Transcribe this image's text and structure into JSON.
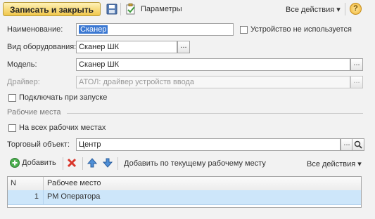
{
  "toolbar": {
    "save_close_label": "Записать и закрыть",
    "params_label": "Параметры",
    "all_actions_label": "Все действия",
    "help_label": "?"
  },
  "form": {
    "name_label": "Наименование:",
    "name_value": "Сканер",
    "unused_label": "Устройство не используется",
    "equipment_type_label": "Вид оборудования:",
    "equipment_type_value": "Сканер ШК",
    "model_label": "Модель:",
    "model_value": "Сканер ШК",
    "driver_label": "Драйвер:",
    "driver_value": "АТОЛ: драйвер устройств ввода",
    "connect_on_start_label": "Подключать при запуске",
    "workplaces_section_label": "Рабочие места",
    "all_workplaces_label": "На всех рабочих местах",
    "trade_object_label": "Торговый объект:",
    "trade_object_value": "Центр"
  },
  "table_toolbar": {
    "add_label": "Добавить",
    "add_current_label": "Добавить по текущему рабочему месту",
    "all_actions_label": "Все действия"
  },
  "table": {
    "headers": [
      "N",
      "Рабочее место"
    ],
    "rows": [
      {
        "n": "1",
        "workplace": "РМ Оператора"
      }
    ]
  },
  "glyphs": {
    "dots": "...",
    "dropdown": "▾",
    "search": "🔍"
  }
}
